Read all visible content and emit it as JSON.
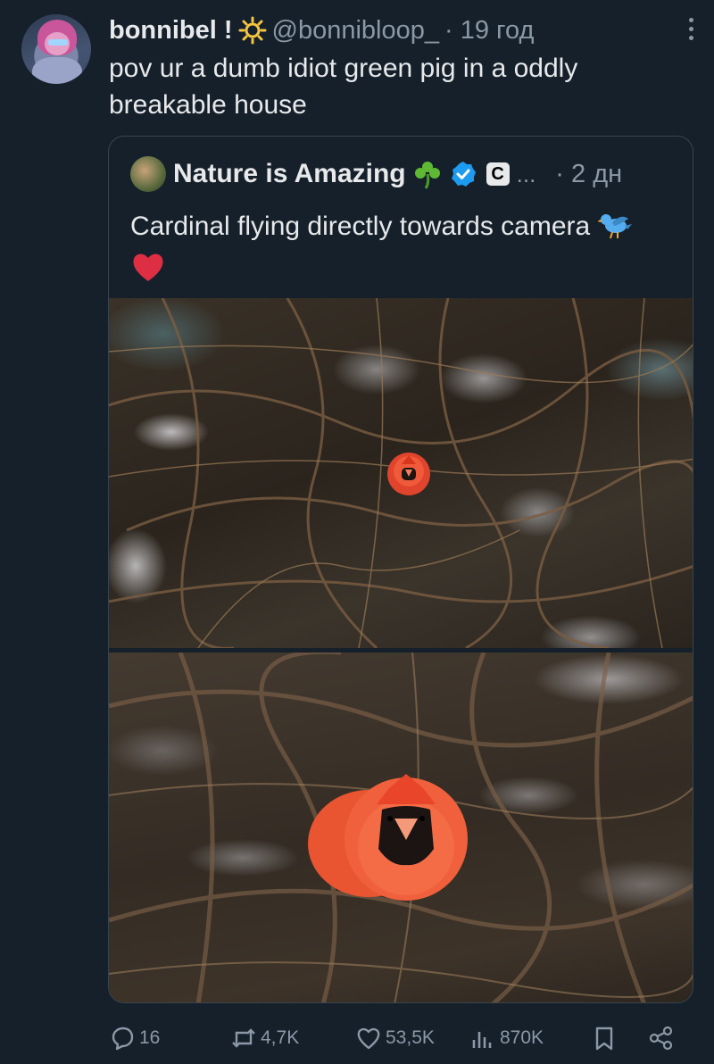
{
  "tweet": {
    "display_name": "bonnibel !",
    "display_emoji": "sun-icon",
    "handle": "@bonnibloop_",
    "time": "· 19 год",
    "text": "pov ur a dumb idiot green pig in a oddly breakable house"
  },
  "quoted": {
    "display_name": "Nature is Amazing",
    "name_emoji": "shamrock-icon",
    "verified": true,
    "affiliate_letter": "C",
    "overflow": "...",
    "time": "· 2 дн",
    "text": "Cardinal flying directly towards camera",
    "text_emojis": [
      "bird-icon",
      "red-heart-icon"
    ],
    "images": [
      {
        "subject": "cardinal-far"
      },
      {
        "subject": "cardinal-near"
      }
    ]
  },
  "actions": {
    "replies": "16",
    "reposts": "4,7K",
    "likes": "53,5K",
    "views": "870K"
  },
  "colors": {
    "background": "#15202b",
    "text": "#e7e9ea",
    "secondary": "#8b98a5",
    "verified": "#1d9bf0",
    "border": "#38444d"
  }
}
